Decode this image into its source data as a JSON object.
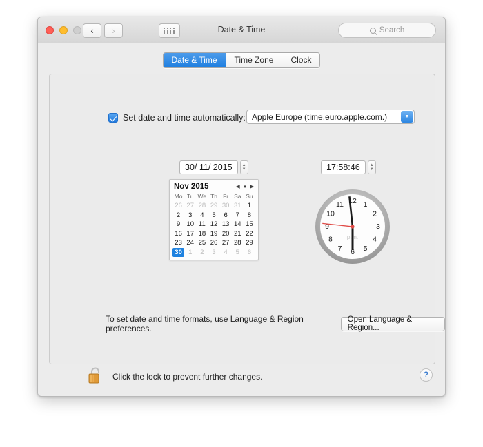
{
  "window": {
    "title": "Date & Time",
    "traffic_lights": [
      "close",
      "minimize",
      "zoom-disabled"
    ],
    "nav": {
      "back": "‹",
      "forward": "›",
      "grid": "grid-icon"
    },
    "search": {
      "placeholder": "Search",
      "value": ""
    }
  },
  "tabs": [
    {
      "label": "Date & Time",
      "active": true
    },
    {
      "label": "Time Zone",
      "active": false
    },
    {
      "label": "Clock",
      "active": false
    }
  ],
  "auto": {
    "checkbox_checked": true,
    "label": "Set date and time automatically:",
    "server": "Apple Europe (time.euro.apple.com.)"
  },
  "date_field": {
    "value": "30/ 11/ 2015"
  },
  "time_field": {
    "value": "17:58:46"
  },
  "calendar": {
    "month_label": "Nov 2015",
    "prev": "◀",
    "today": "●",
    "next": "▶",
    "weekdays": [
      "Mo",
      "Tu",
      "We",
      "Th",
      "Fr",
      "Sa",
      "Su"
    ],
    "selected_day": 30,
    "weeks": [
      [
        {
          "d": "26",
          "o": true
        },
        {
          "d": "27",
          "o": true
        },
        {
          "d": "28",
          "o": true
        },
        {
          "d": "29",
          "o": true
        },
        {
          "d": "30",
          "o": true
        },
        {
          "d": "31",
          "o": true
        },
        {
          "d": "1",
          "o": false
        }
      ],
      [
        {
          "d": "2",
          "o": false
        },
        {
          "d": "3",
          "o": false
        },
        {
          "d": "4",
          "o": false
        },
        {
          "d": "5",
          "o": false
        },
        {
          "d": "6",
          "o": false
        },
        {
          "d": "7",
          "o": false
        },
        {
          "d": "8",
          "o": false
        }
      ],
      [
        {
          "d": "9",
          "o": false
        },
        {
          "d": "10",
          "o": false
        },
        {
          "d": "11",
          "o": false
        },
        {
          "d": "12",
          "o": false
        },
        {
          "d": "13",
          "o": false
        },
        {
          "d": "14",
          "o": false
        },
        {
          "d": "15",
          "o": false
        }
      ],
      [
        {
          "d": "16",
          "o": false
        },
        {
          "d": "17",
          "o": false
        },
        {
          "d": "18",
          "o": false
        },
        {
          "d": "19",
          "o": false
        },
        {
          "d": "20",
          "o": false
        },
        {
          "d": "21",
          "o": false
        },
        {
          "d": "22",
          "o": false
        }
      ],
      [
        {
          "d": "23",
          "o": false
        },
        {
          "d": "24",
          "o": false
        },
        {
          "d": "25",
          "o": false
        },
        {
          "d": "26",
          "o": false
        },
        {
          "d": "27",
          "o": false
        },
        {
          "d": "28",
          "o": false
        },
        {
          "d": "29",
          "o": false
        }
      ],
      [
        {
          "d": "30",
          "o": false,
          "sel": true
        },
        {
          "d": "1",
          "o": true
        },
        {
          "d": "2",
          "o": true
        },
        {
          "d": "3",
          "o": true
        },
        {
          "d": "4",
          "o": true
        },
        {
          "d": "5",
          "o": true
        },
        {
          "d": "6",
          "o": true
        }
      ]
    ]
  },
  "clock": {
    "numerals": [
      "1",
      "2",
      "3",
      "4",
      "5",
      "6",
      "7",
      "8",
      "9",
      "10",
      "11",
      "12"
    ],
    "hour_angle": 180,
    "minute_angle": 354,
    "second_angle": 276,
    "meridiem": "p.m.",
    "second_hand_color": "#e04a46",
    "hand_color": "#1a1a1a"
  },
  "formats": {
    "text": "To set date and time formats, use Language & Region preferences.",
    "button": "Open Language & Region..."
  },
  "lock": {
    "state": "unlocked",
    "label": "Click the lock to prevent further changes.",
    "color": "#e09a38"
  },
  "help": {
    "label": "?"
  }
}
